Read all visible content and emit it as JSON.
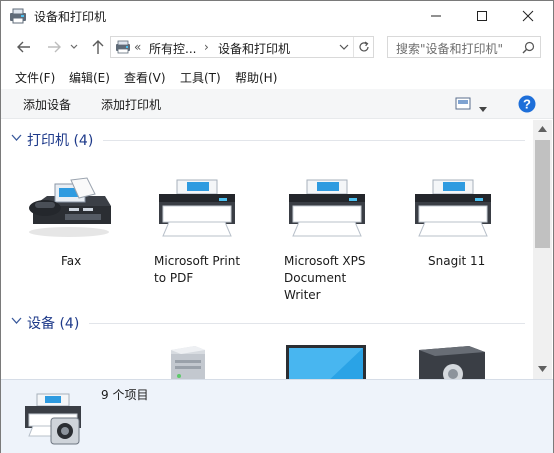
{
  "window": {
    "title": "设备和打印机"
  },
  "address_bar": {
    "prefix": "«",
    "segment_1": "所有控...",
    "separator": "›",
    "segment_2": "设备和打印机"
  },
  "search": {
    "placeholder": "搜索\"设备和打印机\""
  },
  "menu": {
    "items": [
      {
        "label": "文件(F)"
      },
      {
        "label": "编辑(E)"
      },
      {
        "label": "查看(V)"
      },
      {
        "label": "工具(T)"
      },
      {
        "label": "帮助(H)"
      }
    ]
  },
  "commands": {
    "add_device": "添加设备",
    "add_printer": "添加打印机"
  },
  "groups": {
    "printers": {
      "title": "打印机 (4)",
      "items": [
        {
          "label": "Fax",
          "icon": "fax-icon"
        },
        {
          "label": "Microsoft Print\nto PDF",
          "icon": "printer-icon"
        },
        {
          "label": "Microsoft XPS\nDocument\nWriter",
          "icon": "printer-icon"
        },
        {
          "label": "Snagit 11",
          "icon": "printer-icon"
        }
      ]
    },
    "devices": {
      "title": "设备 (4)",
      "items": [
        {
          "icon": "computer-icon"
        },
        {
          "icon": "monitor-icon"
        },
        {
          "icon": "speaker-icon"
        }
      ]
    }
  },
  "details": {
    "count": "9 个项目"
  },
  "colors": {
    "accent_blue": "#1e3a8a",
    "help_blue": "#1e6fd9",
    "details_bg": "#eef3fa"
  }
}
